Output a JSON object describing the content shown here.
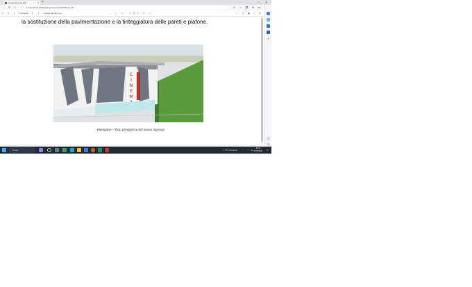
{
  "browser": {
    "tab_title": "computer.rorgo.pdf",
    "new_tab_symbol": "+",
    "window_controls": [
      "–",
      "□",
      "✕"
    ],
    "url": "C:/Users/ibrio.sah/Desktop/computer%20/Rorgo.pdf",
    "nav_icons": [
      "back-arrow-icon",
      "forward-arrow-icon",
      "refresh-icon",
      "home-icon"
    ]
  },
  "pdf_toolbar": {
    "menu_label": "≡",
    "draw_label": "Disegna",
    "read_aloud_label": "Leggi ad alta voce",
    "zoom_out": "−",
    "zoom_in": "+",
    "page_current": "1",
    "page_separator": "di",
    "page_total": "3"
  },
  "document": {
    "paragraph_line": "la sostituzione della pavimentazione e la tinteggiatura delle pareti e plafone.",
    "figure_sign_text": "CINEMA",
    "caption": "Immagine – Vista prospettica del nuovo ingresso"
  },
  "taskbar": {
    "search_placeholder": "Cerca",
    "weather": "17°C  Nuvoloso",
    "time": "10:12",
    "date": "07/05/2021"
  },
  "colors": {
    "taskbar_bg": "#1f2a36",
    "accent": "#0a64c8",
    "sky": "#d6e2e6",
    "grass": "#5a9b3c"
  }
}
